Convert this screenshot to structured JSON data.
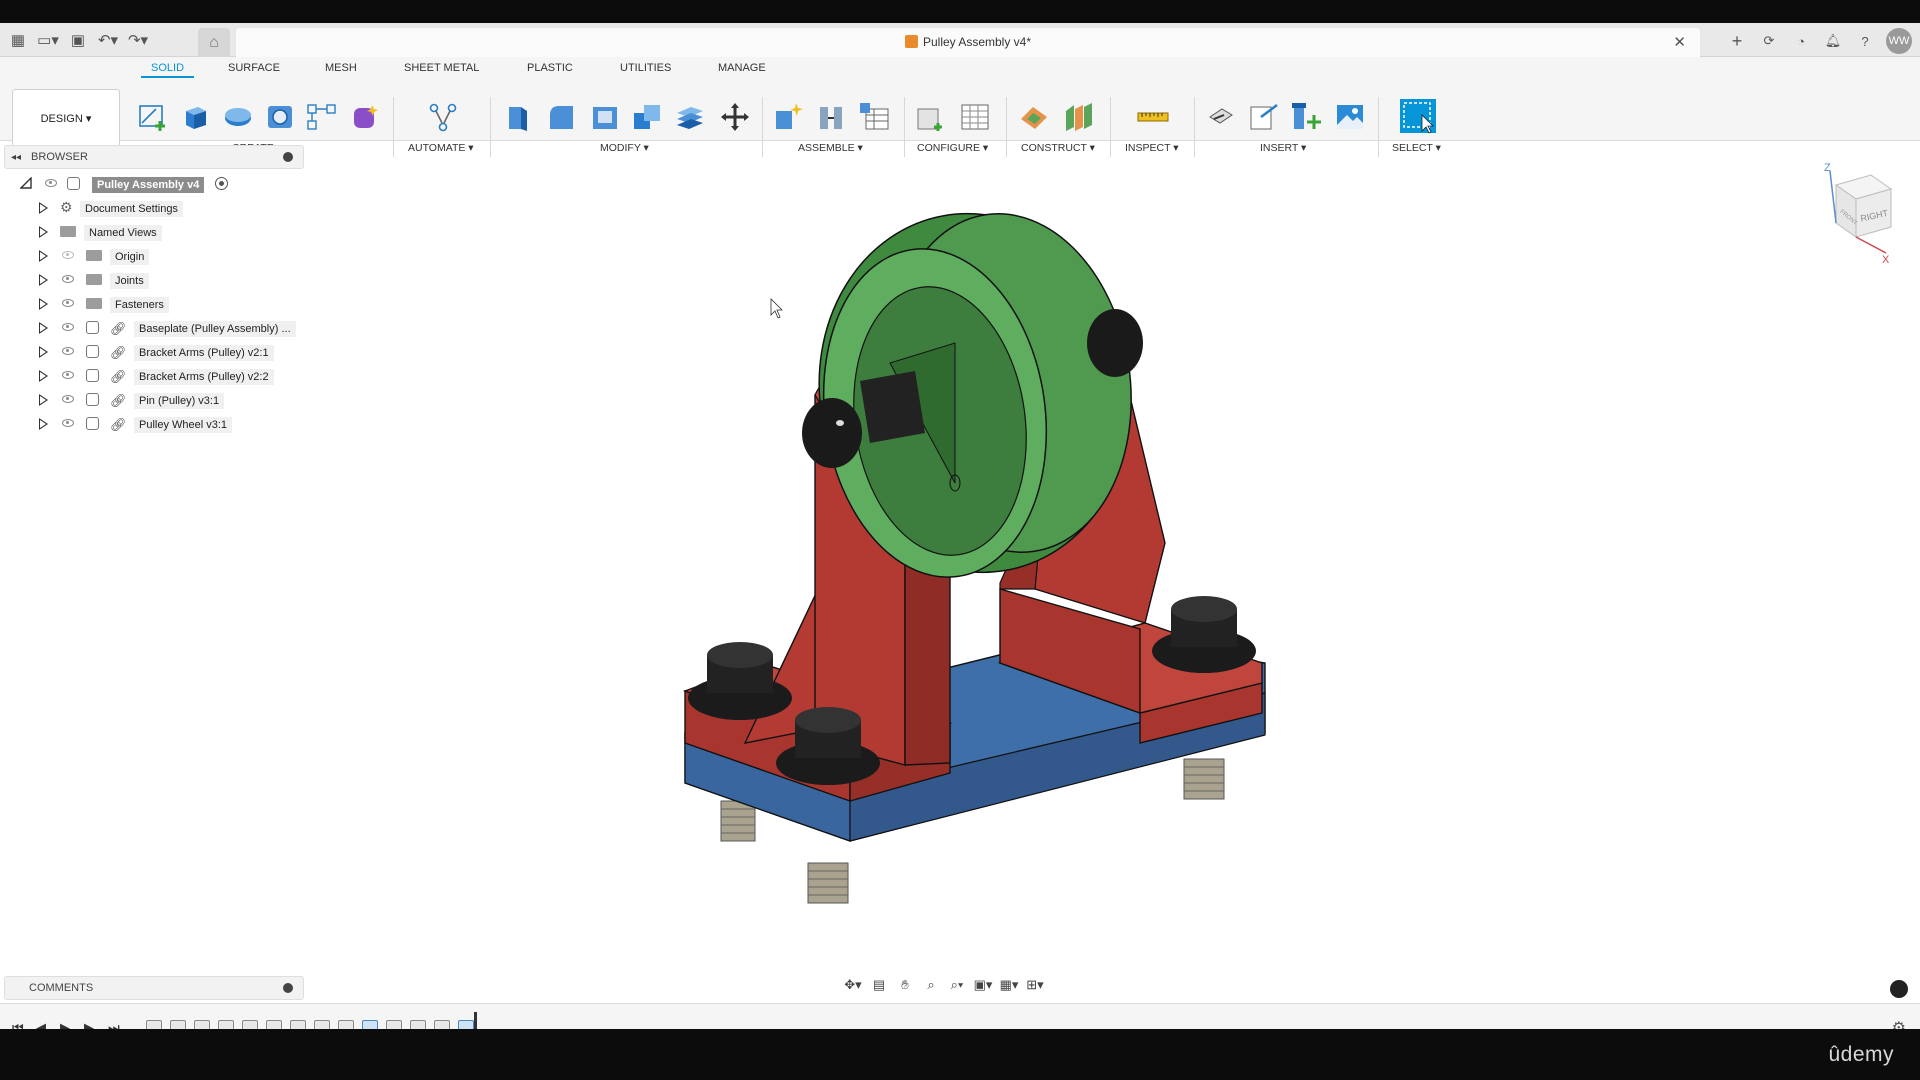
{
  "app": {
    "document_title": "Pulley Assembly v4*",
    "user_initials": "WW",
    "watermark": "ûdemy"
  },
  "ribbon": {
    "tabs": [
      "SOLID",
      "SURFACE",
      "MESH",
      "SHEET METAL",
      "PLASTIC",
      "UTILITIES",
      "MANAGE"
    ],
    "active_tab": "SOLID",
    "workspace": "DESIGN ▾",
    "groups": [
      {
        "label": "CREATE ▾"
      },
      {
        "label": "AUTOMATE ▾"
      },
      {
        "label": "MODIFY ▾"
      },
      {
        "label": "ASSEMBLE ▾"
      },
      {
        "label": "CONFIGURE ▾"
      },
      {
        "label": "CONSTRUCT ▾"
      },
      {
        "label": "INSPECT ▾"
      },
      {
        "label": "INSERT ▾"
      },
      {
        "label": "SELECT ▾"
      }
    ]
  },
  "browser": {
    "title": "BROWSER",
    "root": "Pulley Assembly v4",
    "items": [
      {
        "label": "Document Settings",
        "type": "settings",
        "visible": true
      },
      {
        "label": "Named Views",
        "type": "folder",
        "visible": true
      },
      {
        "label": "Origin",
        "type": "folder",
        "visible": false
      },
      {
        "label": "Joints",
        "type": "folder",
        "visible": true
      },
      {
        "label": "Fasteners",
        "type": "folder",
        "visible": true
      },
      {
        "label": "Baseplate (Pulley Assembly) ...",
        "type": "component-link",
        "visible": true
      },
      {
        "label": "Bracket Arms (Pulley) v2:1",
        "type": "component-link",
        "visible": true
      },
      {
        "label": "Bracket Arms (Pulley) v2:2",
        "type": "component-link",
        "visible": true
      },
      {
        "label": "Pin (Pulley) v3:1",
        "type": "component-link",
        "visible": true
      },
      {
        "label": "Pulley Wheel v3:1",
        "type": "component-link",
        "visible": true
      }
    ]
  },
  "comments": {
    "title": "COMMENTS"
  },
  "viewcube": {
    "face_right": "RIGHT",
    "face_front": "FRONT",
    "axis_z": "Z",
    "axis_x": "X"
  },
  "colors": {
    "accent": "#0696d7",
    "wheel": "#4f9a4f",
    "bracket": "#b33a32",
    "baseplate": "#3f6fa8",
    "fastener": "#1a1a1a"
  }
}
